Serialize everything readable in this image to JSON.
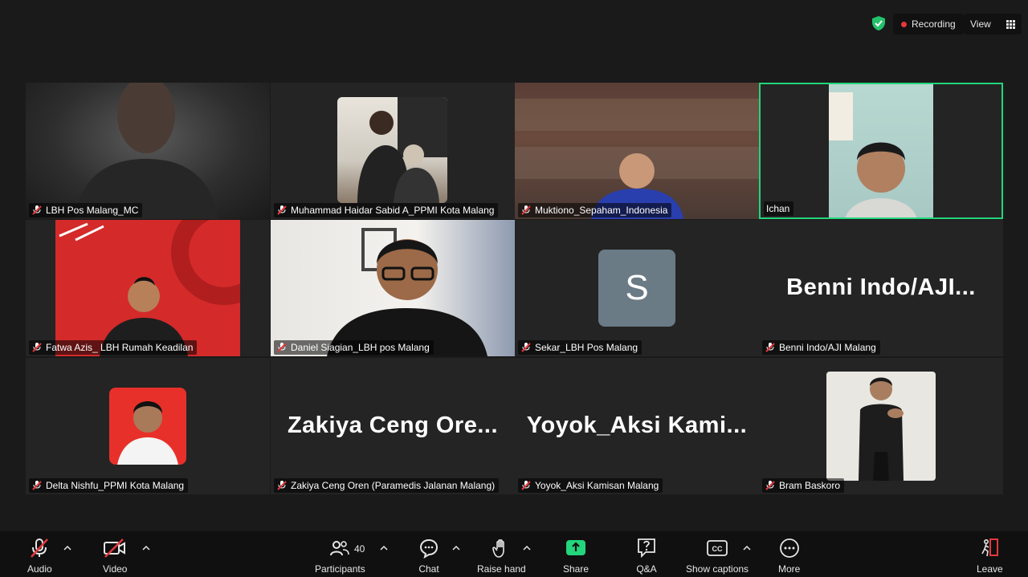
{
  "header": {
    "recording_label": "Recording",
    "view_label": "View"
  },
  "tiles": [
    {
      "name": "LBH Pos Malang_MC"
    },
    {
      "name": "Muhammad Haidar Sabid A_PPMI Kota Malang"
    },
    {
      "name": "Muktiono_Sepaham_Indonesia"
    },
    {
      "name": "Ichan"
    },
    {
      "name": "Fatwa Azis_ LBH Rumah Keadilan"
    },
    {
      "name": "Daniel Siagian_LBH pos Malang"
    },
    {
      "name": "Sekar_LBH Pos Malang",
      "avatar_letter": "S"
    },
    {
      "name": "Benni Indo/AJI Malang",
      "display": "Benni  Indo/AJI..."
    },
    {
      "name": "Delta Nishfu_PPMI Kota Malang"
    },
    {
      "name": "Zakiya Ceng Oren (Paramedis Jalanan Malang)",
      "display": "Zakiya  Ceng  Ore..."
    },
    {
      "name": "Yoyok_Aksi Kamisan Malang",
      "display": "Yoyok_Aksi  Kami..."
    },
    {
      "name": "Bram Baskoro"
    }
  ],
  "toolbar": {
    "audio": "Audio",
    "video": "Video",
    "participants": "Participants",
    "participants_count": "40",
    "chat": "Chat",
    "raise_hand": "Raise hand",
    "share": "Share",
    "qa": "Q&A",
    "show_captions": "Show captions",
    "more": "More",
    "leave": "Leave"
  },
  "colors": {
    "active_speaker": "#23d57c",
    "share": "#23d57c",
    "muted": "#e5383b",
    "recording": "#e5383b"
  }
}
